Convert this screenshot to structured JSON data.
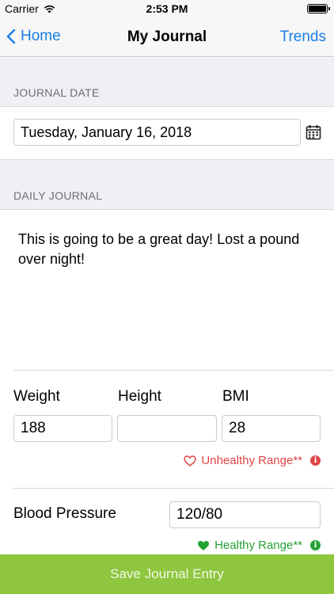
{
  "status_bar": {
    "carrier": "Carrier",
    "time": "2:53 PM"
  },
  "nav": {
    "back_label": "Home",
    "title": "My Journal",
    "right_label": "Trends"
  },
  "journal_date": {
    "header": "JOURNAL DATE",
    "value": "Tuesday, January 16, 2018"
  },
  "daily_journal": {
    "header": "DAILY JOURNAL",
    "text": "This is going to be a great day! Lost a pound over night!"
  },
  "measurements": {
    "weight_label": "Weight",
    "weight_value": "188",
    "height_label": "Height",
    "height_value": "",
    "bmi_label": "BMI",
    "bmi_value": "28",
    "bmi_status": "Unhealthy Range**",
    "bp_label": "Blood Pressure",
    "bp_value": "120/80",
    "bp_status": "Healthy Range**"
  },
  "save_button": {
    "label": "Save Journal Entry"
  },
  "colors": {
    "accent": "#1a7ee6",
    "save": "#8ec63f",
    "unhealthy": "#e04545",
    "healthy": "#26a234"
  },
  "icons": [
    "wifi-icon",
    "battery-icon",
    "chevron-left-icon",
    "calendar-icon",
    "heart-outline-icon",
    "heart-icon",
    "info-icon"
  ]
}
